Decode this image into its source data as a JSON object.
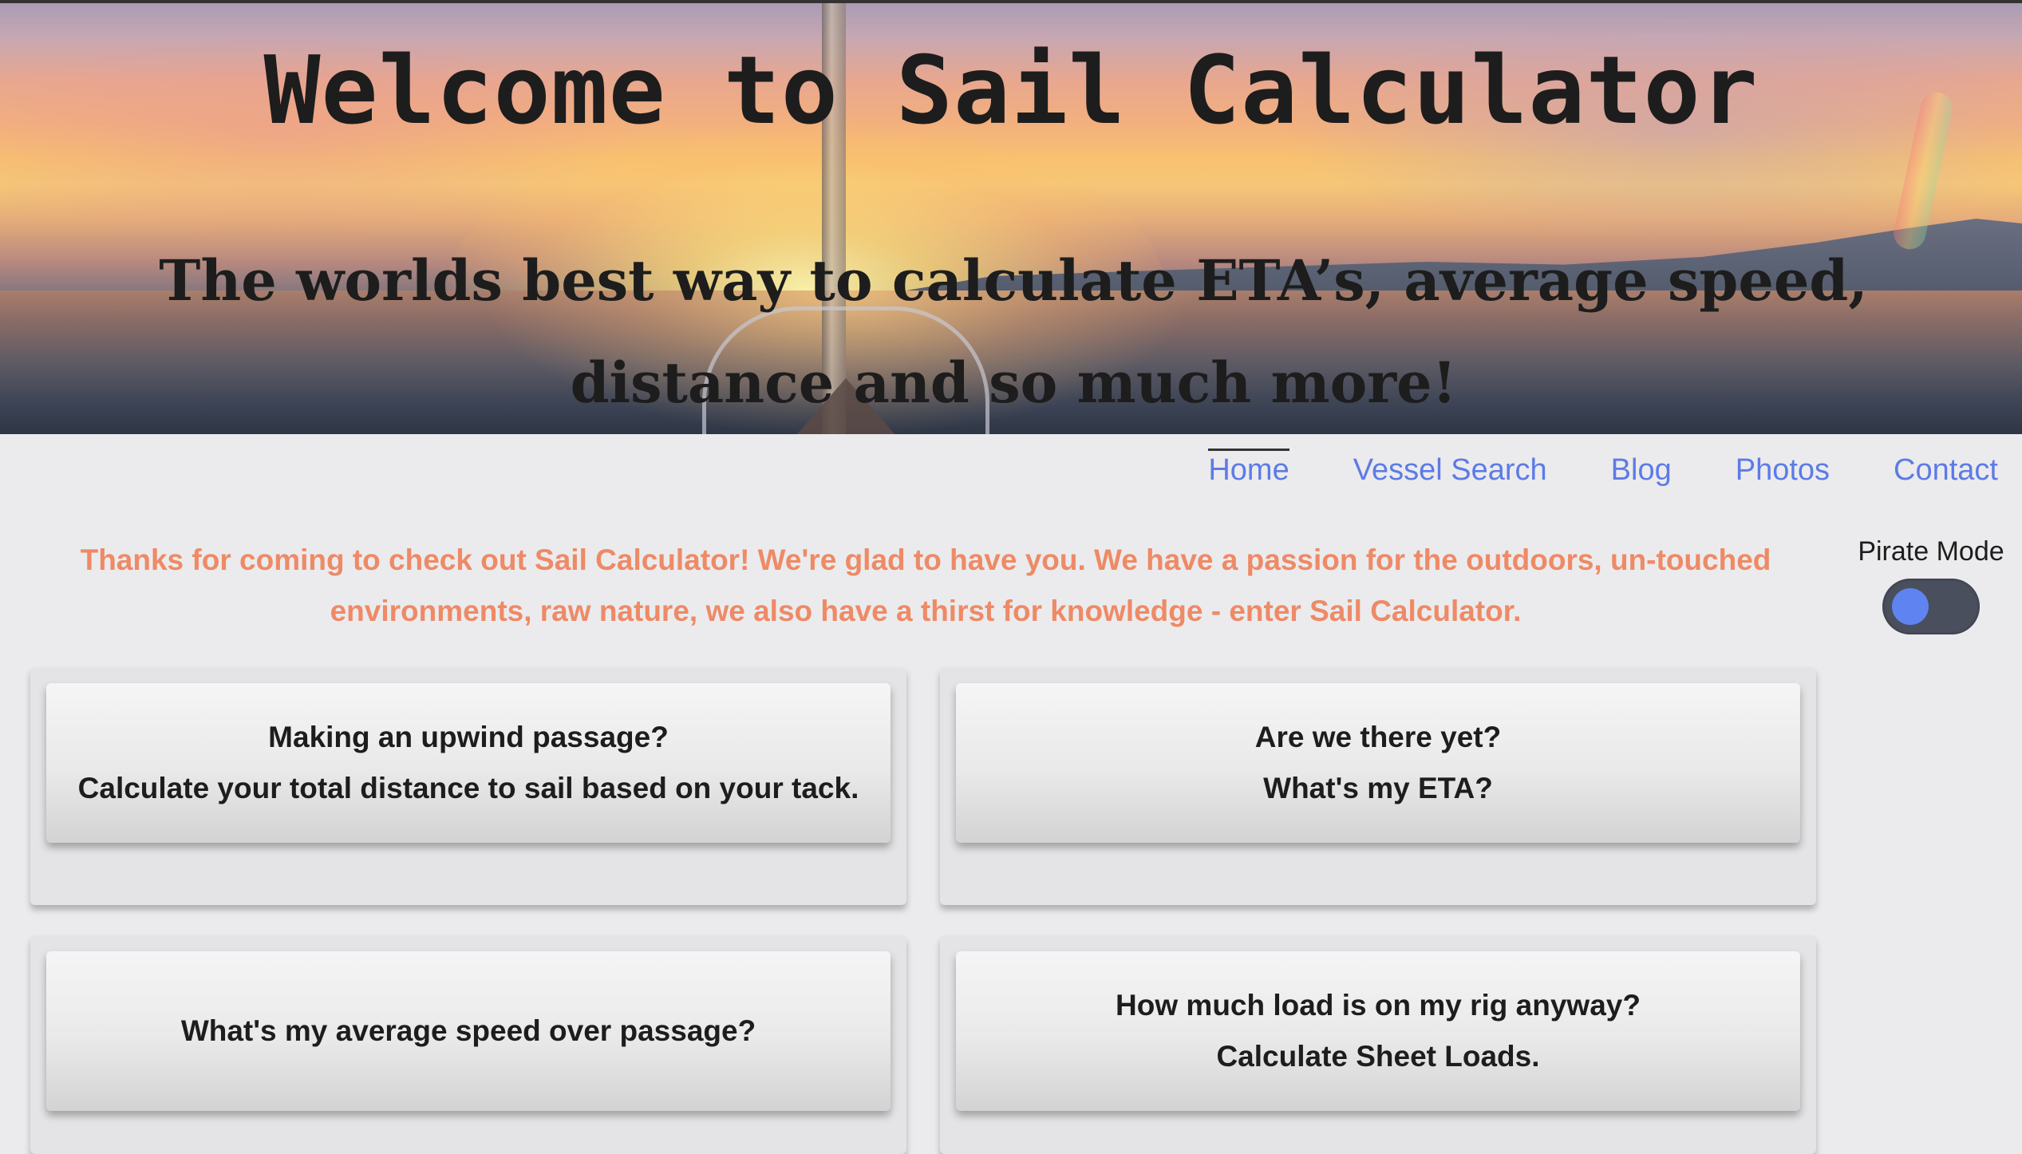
{
  "hero": {
    "title": "Welcome to Sail Calculator",
    "subtitle_line1": "The worlds best way to calculate ETA’s, average speed,",
    "subtitle_line2": "distance and so much more!"
  },
  "nav": {
    "items": [
      {
        "label": "Home",
        "active": true
      },
      {
        "label": "Vessel Search",
        "active": false
      },
      {
        "label": "Blog",
        "active": false
      },
      {
        "label": "Photos",
        "active": false
      },
      {
        "label": "Contact",
        "active": false
      }
    ]
  },
  "intro": {
    "line1": "Thanks for coming to check out Sail Calculator! We're glad to have you. We have a passion for the outdoors, un-touched",
    "line2": "environments, raw nature, we also have a thirst for knowledge - enter Sail Calculator."
  },
  "pirate_mode": {
    "label": "Pirate Mode",
    "enabled": false
  },
  "cards": [
    {
      "line1": "Making an upwind passage?",
      "line2": "Calculate your total distance to sail based on your tack."
    },
    {
      "line1": "Are we there yet?",
      "line2": "What's my ETA?"
    },
    {
      "line1": "What's my average speed over passage?",
      "line2": ""
    },
    {
      "line1": "How much load is on my rig anyway?",
      "line2": "Calculate Sheet Loads."
    }
  ],
  "colors": {
    "accent_link": "#5d7be6",
    "intro_text": "#ee8a66",
    "background": "#ebebed",
    "toggle_knob": "#5f84f2",
    "toggle_track": "#4a4f5e"
  }
}
